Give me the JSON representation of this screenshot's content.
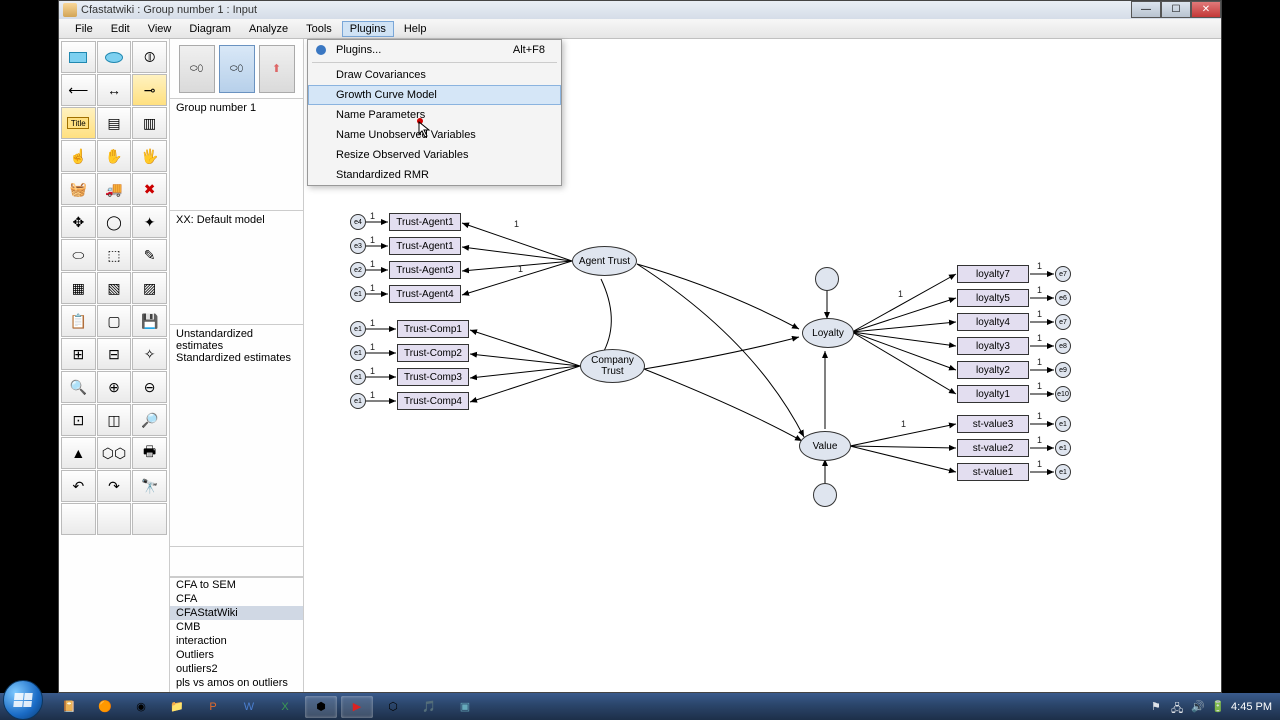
{
  "window": {
    "title": "Cfastatwiki : Group number 1 : Input"
  },
  "menubar": {
    "items": [
      "File",
      "Edit",
      "View",
      "Diagram",
      "Analyze",
      "Tools",
      "Plugins",
      "Help"
    ],
    "open_index": 6
  },
  "dropdown": {
    "plugins_label": "Plugins...",
    "plugins_shortcut": "Alt+F8",
    "items": [
      "Draw Covariances",
      "Growth Curve Model",
      "Name Parameters",
      "Name Unobserved Variables",
      "Resize Observed Variables",
      "Standardized RMR"
    ],
    "hover_index": 1
  },
  "panels": {
    "group_label": "Group number 1",
    "model_label": "XX: Default model",
    "estimates": [
      "Unstandardized estimates",
      "Standardized estimates"
    ],
    "files": [
      "CFA to SEM",
      "CFA",
      "CFAStatWiki",
      "CMB",
      "interaction",
      "Outliers",
      "outliers2",
      "pls vs amos on outliers"
    ],
    "files_selected_index": 2
  },
  "diagram": {
    "errors_left_top": [
      "e4",
      "e3",
      "e2",
      "e1"
    ],
    "observed_left_top": [
      "Trust-Agent1",
      "Trust-Agent1",
      "Trust-Agent3",
      "Trust-Agent4"
    ],
    "errors_left_bot": [
      "e1",
      "e1",
      "e1",
      "e1"
    ],
    "observed_left_bot": [
      "Trust-Comp1",
      "Trust-Comp2",
      "Trust-Comp3",
      "Trust-Comp4"
    ],
    "latent1": "Agent Trust",
    "latent2": "Company\nTrust",
    "latent3": "Loyalty",
    "latent4": "Value",
    "observed_right_loy": [
      "loyalty7",
      "loyalty5",
      "loyalty4",
      "loyalty3",
      "loyalty2",
      "loyalty1"
    ],
    "errors_right_loy": [
      "e7",
      "e6",
      "e7",
      "e8",
      "e9",
      "e10"
    ],
    "observed_right_val": [
      "st-value3",
      "st-value2",
      "st-value1"
    ],
    "errors_right_val": [
      "e1",
      "e1",
      "e1"
    ],
    "path_one": "1"
  },
  "toolbox": {
    "title_label": "Title"
  },
  "taskbar": {
    "time": "4:45 PM"
  }
}
